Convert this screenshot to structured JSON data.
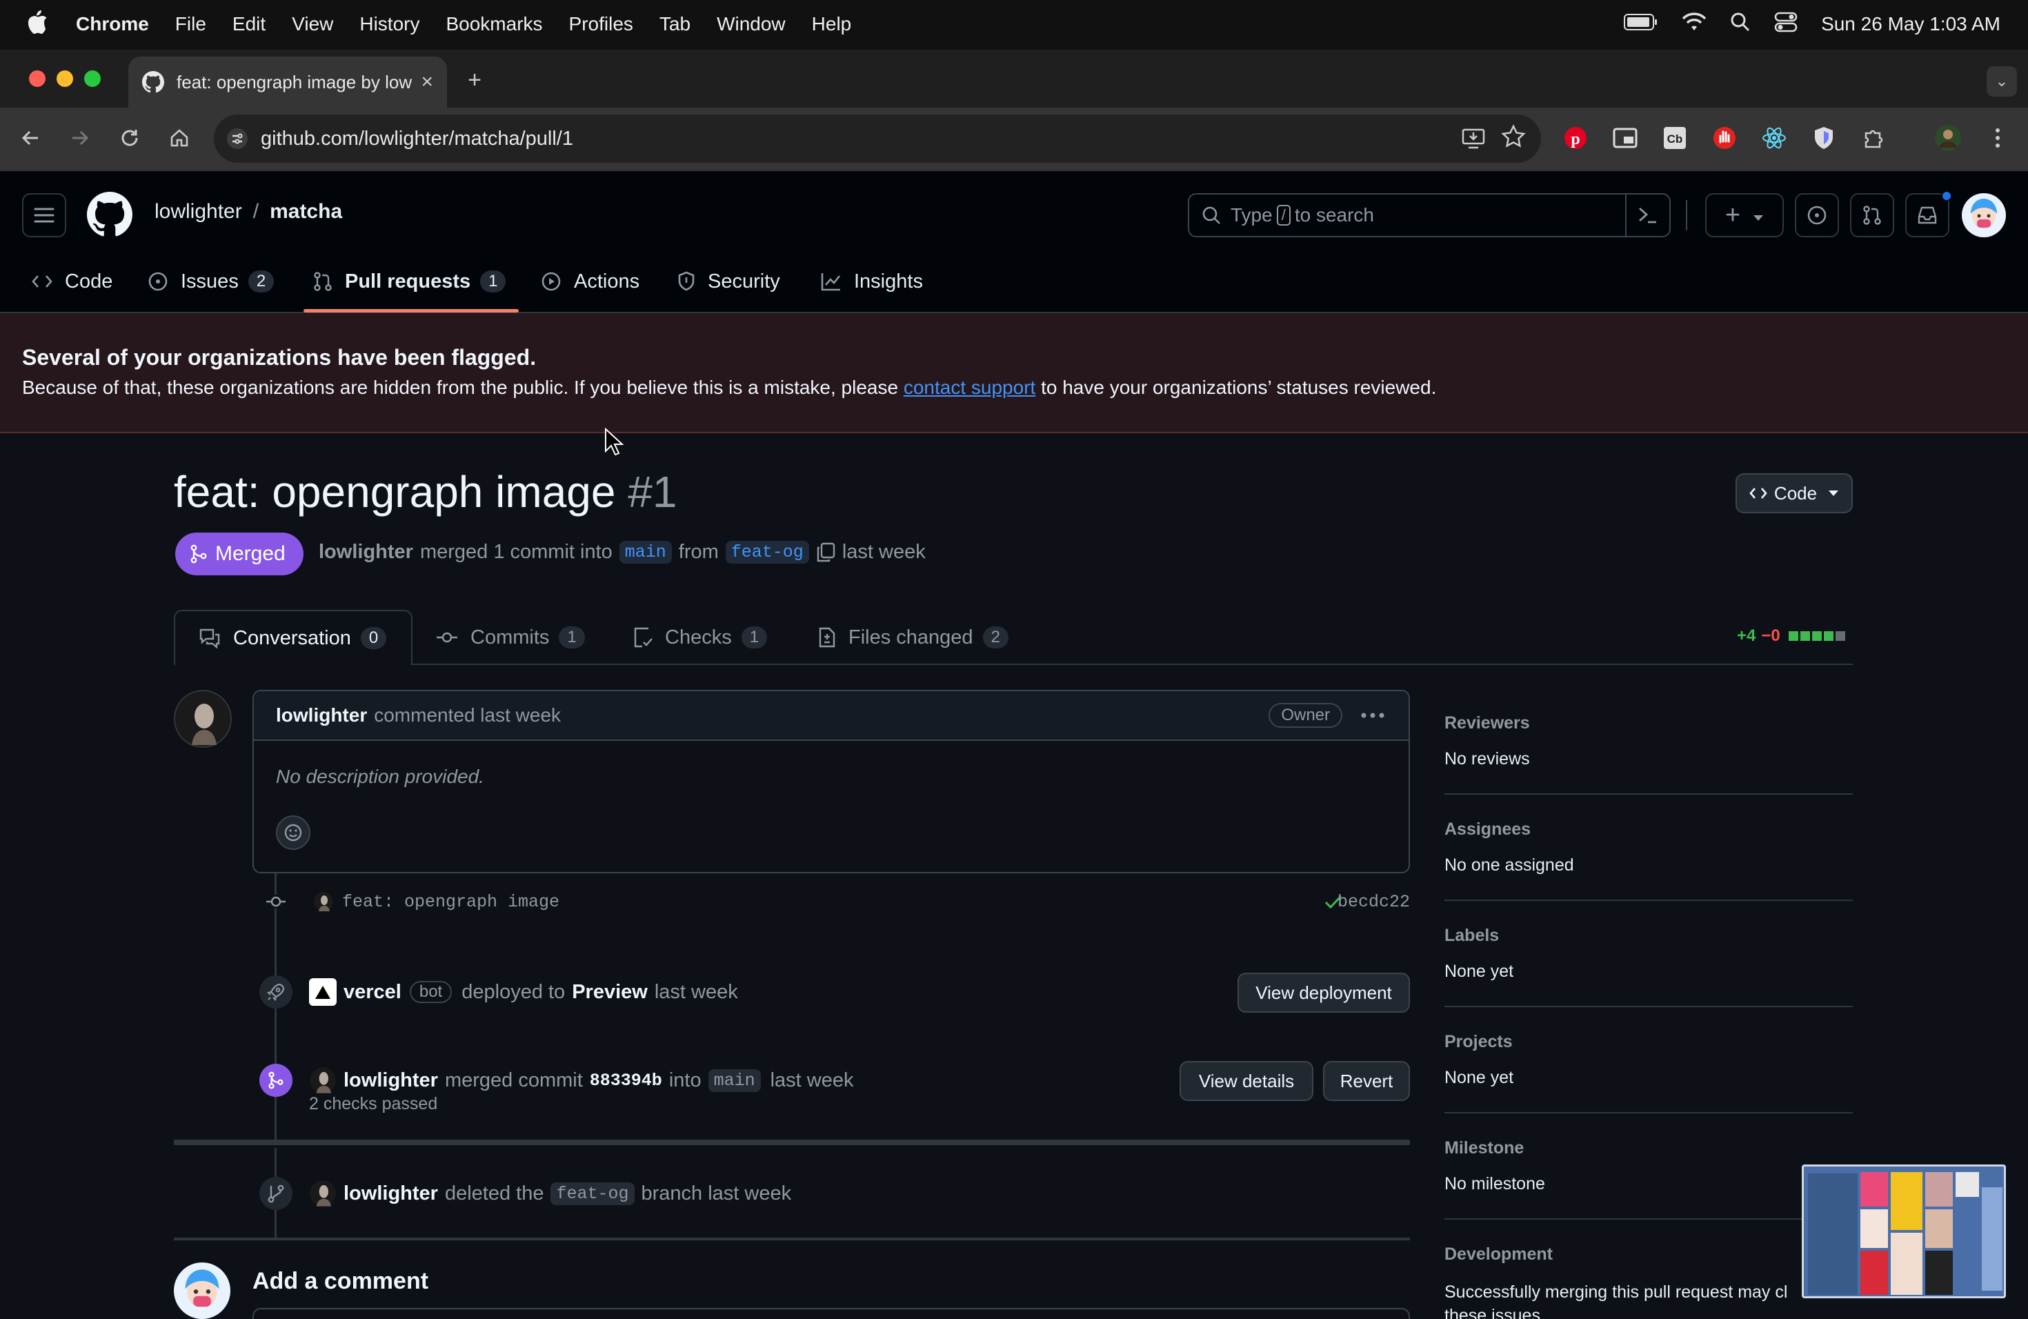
{
  "menubar": {
    "app": "Chrome",
    "items": [
      "File",
      "Edit",
      "View",
      "History",
      "Bookmarks",
      "Profiles",
      "Tab",
      "Window",
      "Help"
    ],
    "clock": "Sun 26 May  1:03 AM"
  },
  "browser": {
    "tab_title": "feat: opengraph image by low",
    "url": "github.com/lowlighter/matcha/pull/1"
  },
  "github": {
    "owner": "lowlighter",
    "separator": "/",
    "repo": "matcha",
    "search_placeholder_pre": "Type",
    "search_key": "/",
    "search_placeholder_post": "to search",
    "tabs": [
      {
        "label": "Code"
      },
      {
        "label": "Issues",
        "count": "2"
      },
      {
        "label": "Pull requests",
        "count": "1"
      },
      {
        "label": "Actions"
      },
      {
        "label": "Security"
      },
      {
        "label": "Insights"
      }
    ]
  },
  "banner": {
    "title": "Several of your organizations have been flagged.",
    "text_before": "Because of that, these organizations are hidden from the public. If you believe this is a mistake, please",
    "link": "contact support",
    "text_after": "to have your organizations’ statuses reviewed."
  },
  "pr": {
    "title": "feat: opengraph image",
    "number": "#1",
    "code_button": "Code",
    "state": "Merged",
    "author": "lowlighter",
    "merged_text": "merged 1 commit into",
    "base": "main",
    "from_text": "from",
    "head": "feat-og",
    "when": "last week",
    "diffstat_add": "+4",
    "diffstat_del": "−0",
    "tabs": [
      {
        "label": "Conversation",
        "count": "0"
      },
      {
        "label": "Commits",
        "count": "1"
      },
      {
        "label": "Checks",
        "count": "1"
      },
      {
        "label": "Files changed",
        "count": "2"
      }
    ]
  },
  "comment": {
    "author": "lowlighter",
    "meta": "commented last week",
    "role": "Owner",
    "body": "No description provided."
  },
  "timeline": {
    "commit_msg": "feat: opengraph image",
    "commit_sha": "becdc22",
    "deploy_actor": "vercel",
    "deploy_bot": "bot",
    "deploy_text": "deployed to",
    "deploy_env": "Preview",
    "deploy_when": "last week",
    "view_deployment": "View deployment",
    "merge_actor": "lowlighter",
    "merge_text": "merged commit",
    "merge_sha": "883394b",
    "merge_into": "into",
    "merge_base": "main",
    "merge_when": "last week",
    "checks": "2 checks passed",
    "view_details": "View details",
    "revert": "Revert",
    "delete_actor": "lowlighter",
    "delete_text": "deleted the",
    "delete_branch": "feat-og",
    "delete_when": "branch last week",
    "add_comment": "Add a comment"
  },
  "sidebar": {
    "reviewers_h": "Reviewers",
    "reviewers_v": "No reviews",
    "assignees_h": "Assignees",
    "assignees_v": "No one assigned",
    "labels_h": "Labels",
    "labels_v": "None yet",
    "projects_h": "Projects",
    "projects_v": "None yet",
    "milestone_h": "Milestone",
    "milestone_v": "No milestone",
    "development_h": "Development",
    "development_v": "Successfully merging this pull request may cl",
    "development_v2": "these issues."
  },
  "colors": {
    "merged": "#8957e5",
    "link": "#4493f8",
    "add": "#3fb950",
    "del": "#f85149",
    "tab_underline": "#f78166"
  }
}
